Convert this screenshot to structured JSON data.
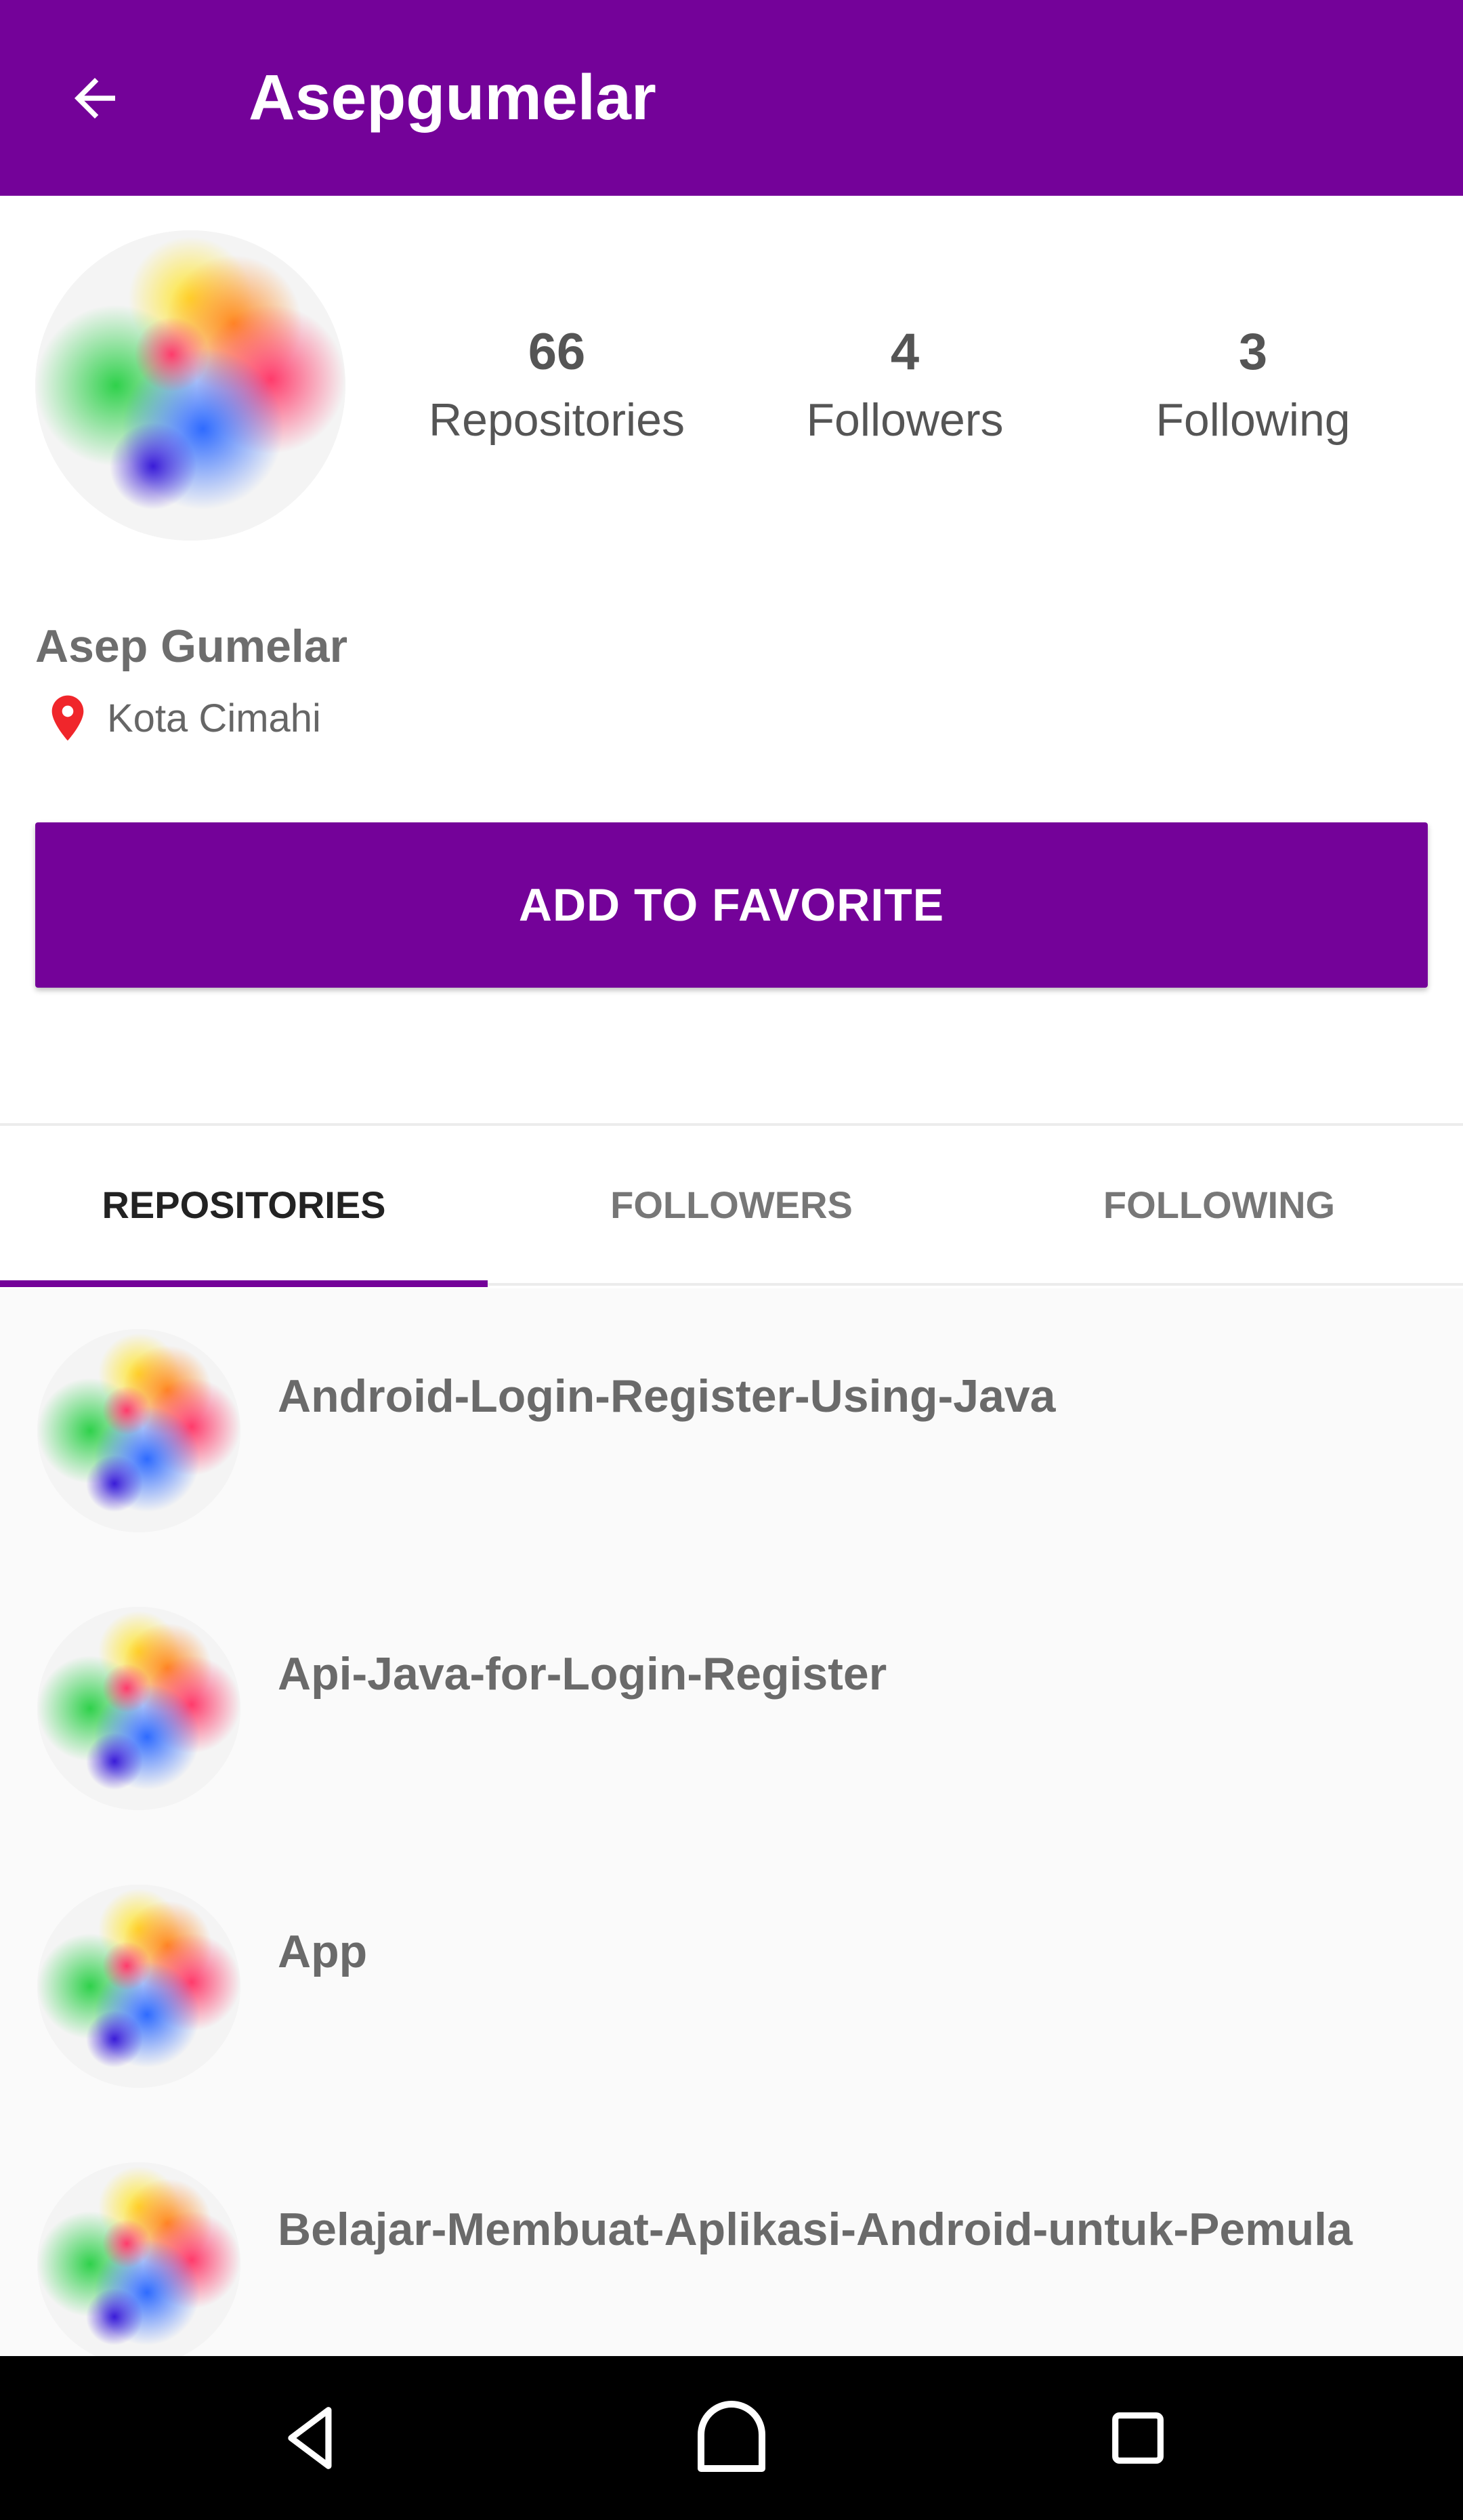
{
  "appbar": {
    "title": "Asepgumelar",
    "back_icon": "arrow-back-icon",
    "color": "#740299"
  },
  "profile": {
    "avatar_icon": "color-splash-avatar",
    "name": "Asep Gumelar",
    "location_icon": "location-pin-icon",
    "location": "Kota Cimahi"
  },
  "stats": [
    {
      "value": "66",
      "label": "Repositories"
    },
    {
      "value": "4",
      "label": "Followers"
    },
    {
      "value": "3",
      "label": "Following"
    }
  ],
  "favorite_button": {
    "label": "ADD TO FAVORITE"
  },
  "tabs": [
    {
      "label": "REPOSITORIES",
      "active": true
    },
    {
      "label": "FOLLOWERS",
      "active": false
    },
    {
      "label": "FOLLOWING",
      "active": false
    }
  ],
  "repositories": [
    {
      "name": "Android-Login-Register-Using-Java"
    },
    {
      "name": "Api-Java-for-Login-Register"
    },
    {
      "name": "App"
    },
    {
      "name": "Belajar-Membuat-Aplikasi-Android-untuk-Pemula"
    }
  ],
  "navbar": {
    "back_icon": "nav-back-icon",
    "home_icon": "nav-home-icon",
    "recents_icon": "nav-recents-icon"
  }
}
